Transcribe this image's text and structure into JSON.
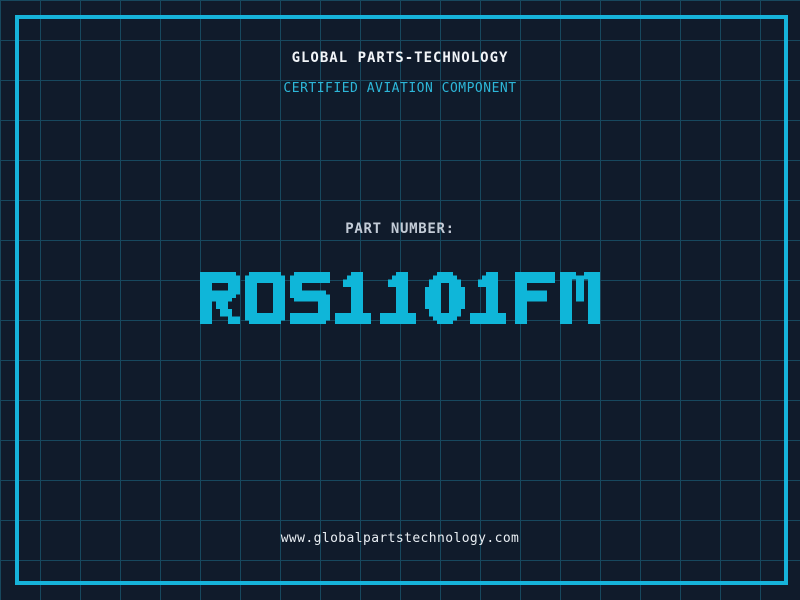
{
  "header": {
    "company": "GLOBAL PARTS-TECHNOLOGY",
    "subtitle": "CERTIFIED AVIATION COMPONENT"
  },
  "part": {
    "label": "PART NUMBER:",
    "number": "ROS1101FM"
  },
  "footer": {
    "website": "www.globalpartstechnology.com"
  },
  "colors": {
    "background": "#101b2b",
    "grid_line": "#17485e",
    "frame": "#16b3da",
    "part_number": "#0fb6d9",
    "subtitle": "#2db7d9",
    "company_text": "#f2f5f8",
    "part_label": "#c3cbd6",
    "website_text": "#e9eef3"
  }
}
